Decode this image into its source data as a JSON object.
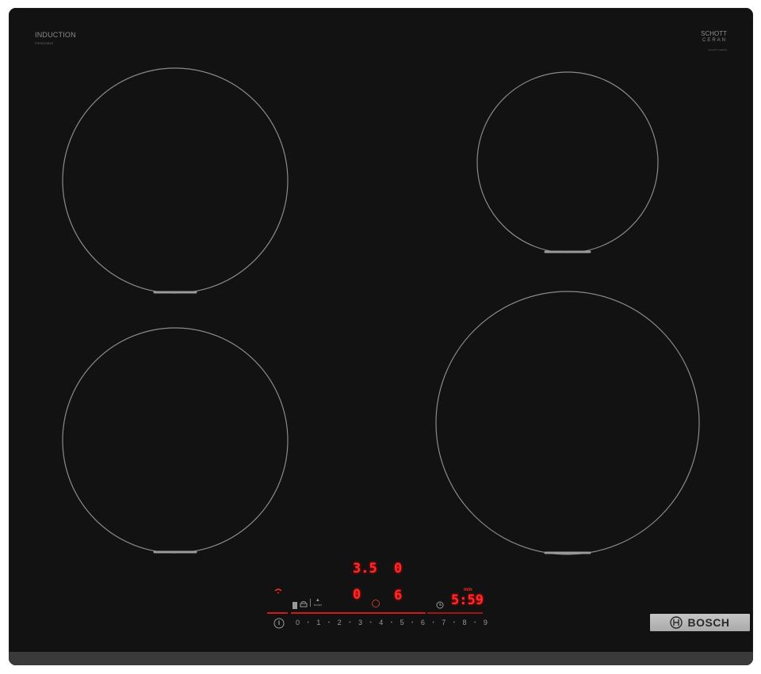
{
  "branding": {
    "induction_label": "INDUCTION",
    "model_label": "PIE631HB1E",
    "ceran_line1": "SCHOTT",
    "ceran_line2": "CERAN",
    "ceran_sub": "SCHOTT CERAN",
    "brand_name": "BOSCH"
  },
  "zones": [
    {
      "id": "front-left",
      "shape": "circle"
    },
    {
      "id": "rear-left",
      "shape": "circle"
    },
    {
      "id": "rear-right",
      "shape": "circle"
    },
    {
      "id": "front-right",
      "shape": "circle"
    }
  ],
  "control_panel": {
    "rear_left_level": "3.5",
    "rear_right_level": "0",
    "front_left_level": "0",
    "front_right_level": "6",
    "timer_display": "5:59",
    "power_level_label": "min",
    "boost_label": "boost",
    "scale": [
      "0",
      "1",
      "2",
      "3",
      "4",
      "5",
      "6",
      "7",
      "8",
      "9"
    ]
  },
  "colors": {
    "glass": "#121212",
    "zone_outline": "#8a8a8a",
    "display_red": "#ff2a2a",
    "brand_plate": "#b5b5b5"
  }
}
